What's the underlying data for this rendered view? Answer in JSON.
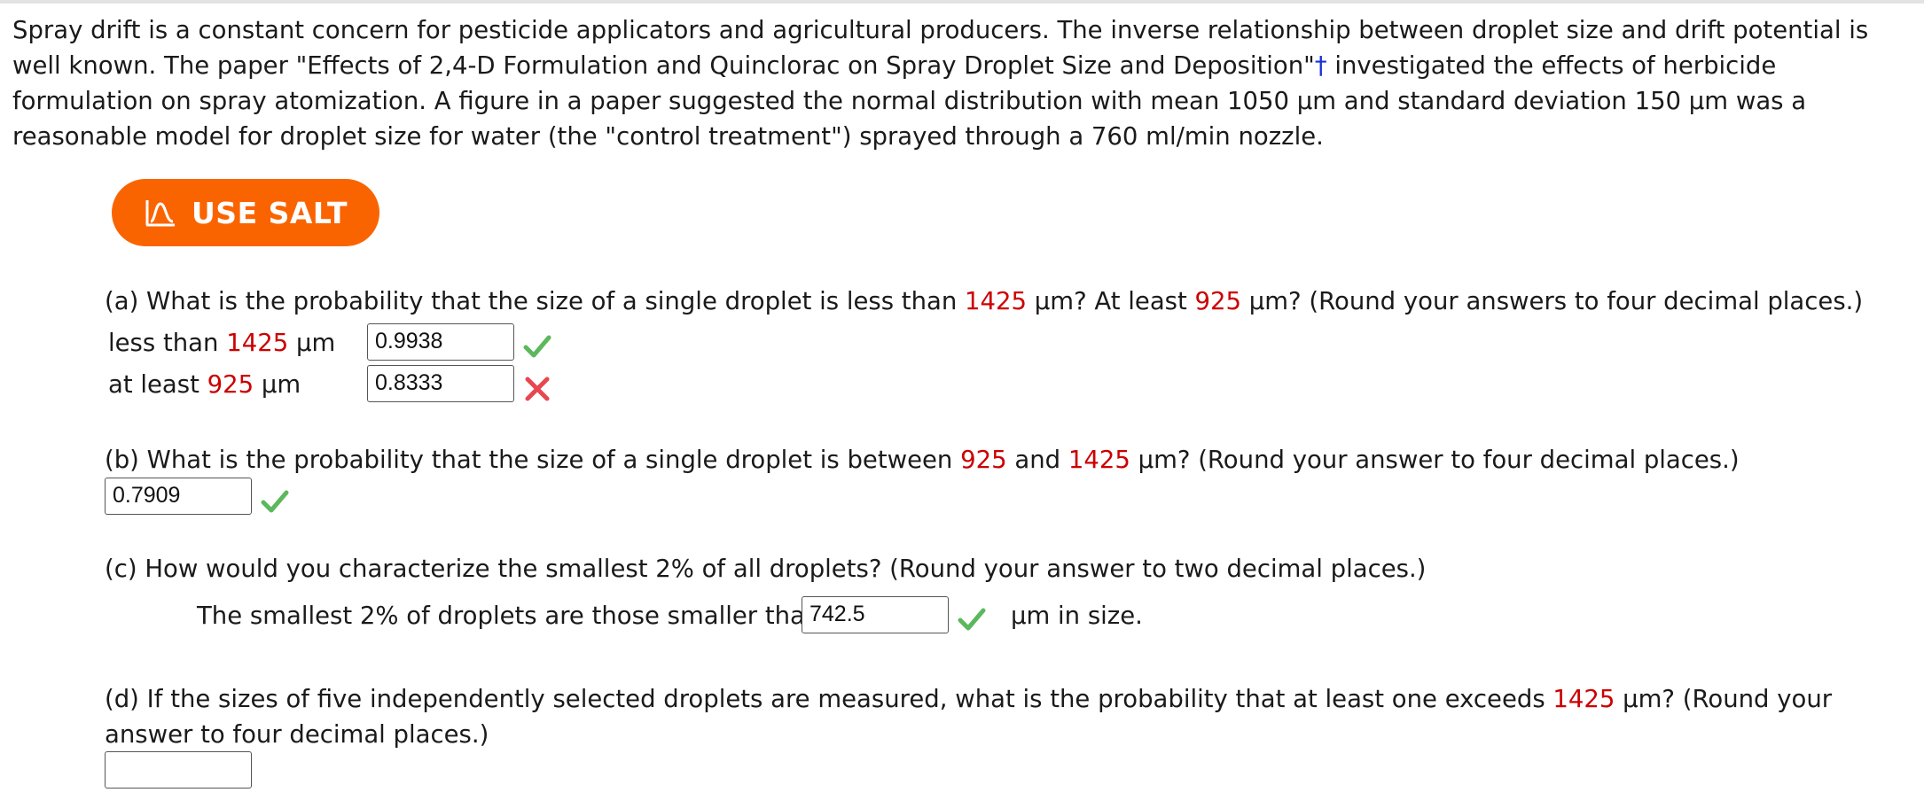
{
  "intro": {
    "part1": "Spray drift is a constant concern for pesticide applicators and agricultural producers. The inverse relationship between droplet size and drift potential is well known. The paper \"Effects of 2,4-D Formulation and Quinclorac on Spray Droplet Size and Deposition\"",
    "dagger": "†",
    "part2": " investigated the effects of herbicide formulation on spray atomization. A figure in a paper suggested the normal distribution with mean 1050 μm and standard deviation 150 μm was a reasonable model for droplet size for water (the \"control treatment\") sprayed through a 760 ml/min nozzle."
  },
  "salt_button": {
    "label": "USE SALT",
    "icon": "salt-distribution-icon",
    "color": "#fa6400"
  },
  "colors": {
    "highlight": "#cc0000",
    "check": "#5cb85c",
    "cross": "#e8474f"
  },
  "part_a": {
    "q_pre": "(a) What is the probability that the size of a single droplet is less than ",
    "v1": "1425",
    "q_mid": " μm? At least ",
    "v2": "925",
    "q_post": " μm? (Round your answers to four decimal places.)",
    "row1": {
      "pre": "less than ",
      "value": "1425",
      "unit": " μm",
      "answer": "0.9938",
      "status": "correct"
    },
    "row2": {
      "pre": "at least ",
      "value": "925",
      "unit": " μm",
      "answer": "0.8333",
      "status": "incorrect"
    }
  },
  "part_b": {
    "q_pre": "(b) What is the probability that the size of a single droplet is between ",
    "v1": "925",
    "q_mid": " and ",
    "v2": "1425",
    "q_post": " μm? (Round your answer to four decimal places.)",
    "answer": "0.7909",
    "status": "correct"
  },
  "part_c": {
    "question": "(c) How would you characterize the smallest 2% of all droplets? (Round your answer to two decimal places.)",
    "pre": "The smallest 2% of droplets are those smaller than",
    "answer": "742.5",
    "status": "correct",
    "post": "μm in size."
  },
  "part_d": {
    "q_pre": "(d) If the sizes of five independently selected droplets are measured, what is the probability that at least one exceeds ",
    "v1": "1425",
    "q_post": " μm? (Round your answer to four decimal places.)",
    "answer": ""
  }
}
